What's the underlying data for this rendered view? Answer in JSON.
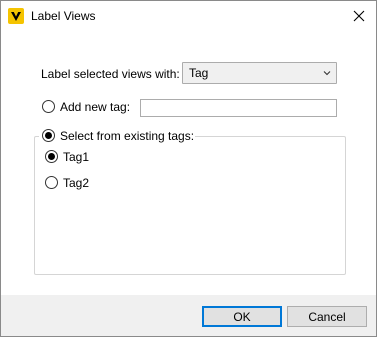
{
  "window": {
    "title": "Label Views",
    "app_icon": "v-logo-icon",
    "accent_color": "#f5c400"
  },
  "form": {
    "label_with_text": "Label selected views with:",
    "label_with_selected": "Tag",
    "add_new_tag": {
      "label": "Add new tag:",
      "checked": false,
      "value": ""
    },
    "select_existing": {
      "label": "Select from existing tags:",
      "checked": true
    },
    "tags": [
      {
        "label": "Tag1",
        "checked": true
      },
      {
        "label": "Tag2",
        "checked": false
      }
    ]
  },
  "buttons": {
    "ok": "OK",
    "cancel": "Cancel"
  }
}
